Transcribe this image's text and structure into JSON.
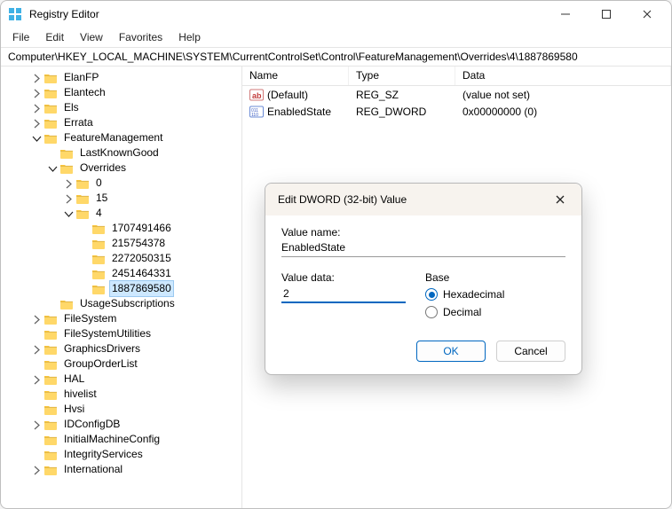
{
  "window": {
    "title": "Registry Editor"
  },
  "menu": {
    "file": "File",
    "edit": "Edit",
    "view": "View",
    "favorites": "Favorites",
    "help": "Help"
  },
  "address": "Computer\\HKEY_LOCAL_MACHINE\\SYSTEM\\CurrentControlSet\\Control\\FeatureManagement\\Overrides\\4\\1887869580",
  "tree": {
    "elanfp": "ElanFP",
    "elantech": "Elantech",
    "els": "Els",
    "errata": "Errata",
    "featuremanagement": "FeatureManagement",
    "lastknowngood": "LastKnownGood",
    "overrides": "Overrides",
    "n0": "0",
    "n15": "15",
    "n4": "4",
    "c1": "1707491466",
    "c2": "215754378",
    "c3": "2272050315",
    "c4": "2451464331",
    "c5": "1887869580",
    "usagesubscriptions": "UsageSubscriptions",
    "filesystem": "FileSystem",
    "filesystemutilities": "FileSystemUtilities",
    "graphicsdrivers": "GraphicsDrivers",
    "grouporderlist": "GroupOrderList",
    "hal": "HAL",
    "hivelist": "hivelist",
    "hvsi": "Hvsi",
    "idconfigdb": "IDConfigDB",
    "initialmachineconfig": "InitialMachineConfig",
    "integrityservices": "IntegrityServices",
    "international": "International"
  },
  "list": {
    "headers": {
      "name": "Name",
      "type": "Type",
      "data": "Data"
    },
    "rows": [
      {
        "icon": "string",
        "name": "(Default)",
        "type": "REG_SZ",
        "data": "(value not set)"
      },
      {
        "icon": "binary",
        "name": "EnabledState",
        "type": "REG_DWORD",
        "data": "0x00000000 (0)"
      }
    ]
  },
  "dialog": {
    "title": "Edit DWORD (32-bit) Value",
    "valuename_label": "Value name:",
    "valuename": "EnabledState",
    "valuedata_label": "Value data:",
    "valuedata": "2",
    "base_label": "Base",
    "hex_label": "Hexadecimal",
    "dec_label": "Decimal",
    "ok": "OK",
    "cancel": "Cancel"
  }
}
